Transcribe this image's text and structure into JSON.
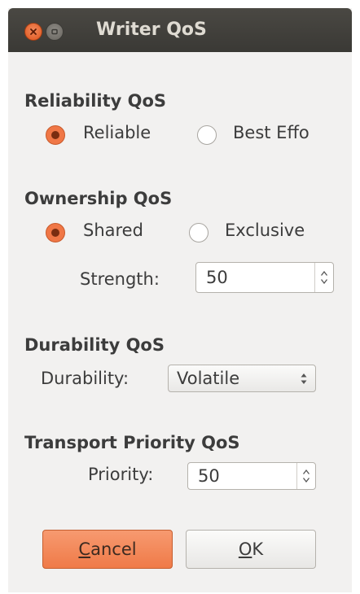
{
  "window": {
    "title": "Writer QoS"
  },
  "reliability": {
    "heading": "Reliability QoS",
    "options": [
      {
        "label": "Reliable",
        "selected": true
      },
      {
        "label": "Best Effo",
        "selected": false
      }
    ]
  },
  "ownership": {
    "heading": "Ownership QoS",
    "options": [
      {
        "label": "Shared",
        "selected": true
      },
      {
        "label": "Exclusive",
        "selected": false
      }
    ],
    "strength_label": "Strength:",
    "strength_value": "50"
  },
  "durability": {
    "heading": "Durability QoS",
    "label": "Durability:",
    "value": "Volatile"
  },
  "transport_priority": {
    "heading": "Transport Priority QoS",
    "label": "Priority:",
    "value": "50"
  },
  "buttons": {
    "cancel_mnemonic": "C",
    "cancel_rest": "ancel",
    "ok_mnemonic": "O",
    "ok_rest": "K"
  },
  "colors": {
    "accent": "#f07746",
    "titlebar": "#3c3b37",
    "window_bg": "#f2f1f0"
  },
  "icons": {
    "close": "close-icon",
    "minimize": "minimize-icon"
  }
}
